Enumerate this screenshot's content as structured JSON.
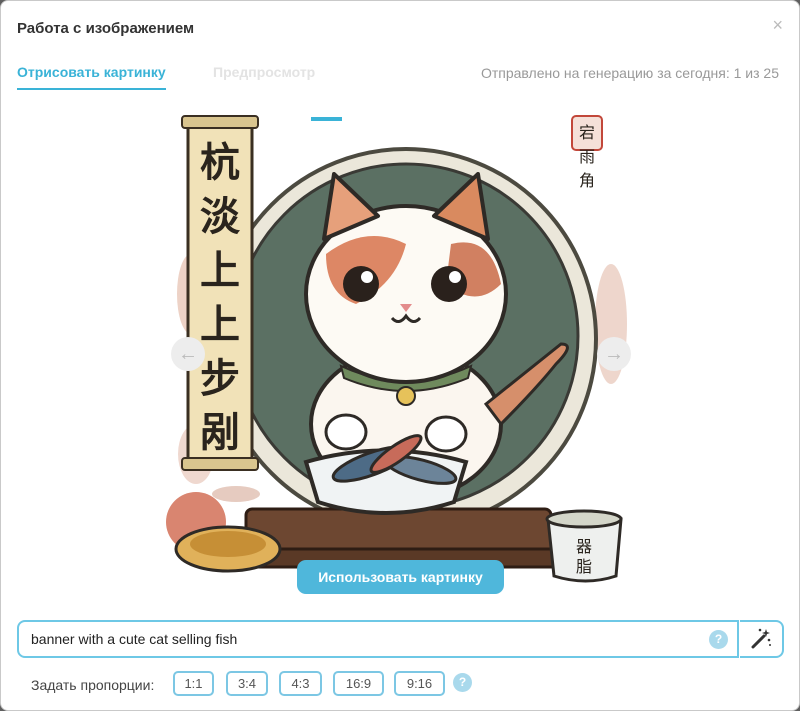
{
  "modal": {
    "title": "Работа с изображением",
    "close_icon": "close-icon"
  },
  "tabs": [
    {
      "label": "Отрисовать картинку",
      "active": true
    },
    {
      "label": "Предпросмотр",
      "active": false
    }
  ],
  "counter": "Отправлено на генерацию за сегодня: 1 из 25",
  "image": {
    "subject": "cute cat selling fish",
    "scroll_chars": [
      "杭",
      "淡",
      "上",
      "上",
      "步",
      "剐"
    ],
    "stamp_chars": [
      "宕",
      "雨",
      "角"
    ],
    "cup_chars": [
      "器",
      "脂"
    ]
  },
  "carousel": {
    "slides_total": 3,
    "active_index": 0
  },
  "use_button": "Использовать картинку",
  "prompt": {
    "value": "banner with a cute cat selling fish",
    "help": "?"
  },
  "ratios": {
    "label": "Задать пропорции:",
    "options": [
      "1:1",
      "3:4",
      "4:3",
      "16:9",
      "9:16"
    ],
    "help": "?"
  },
  "colors": {
    "accent": "#3ab3d7",
    "button": "#4fb7db",
    "border": "#6ec8e6"
  }
}
